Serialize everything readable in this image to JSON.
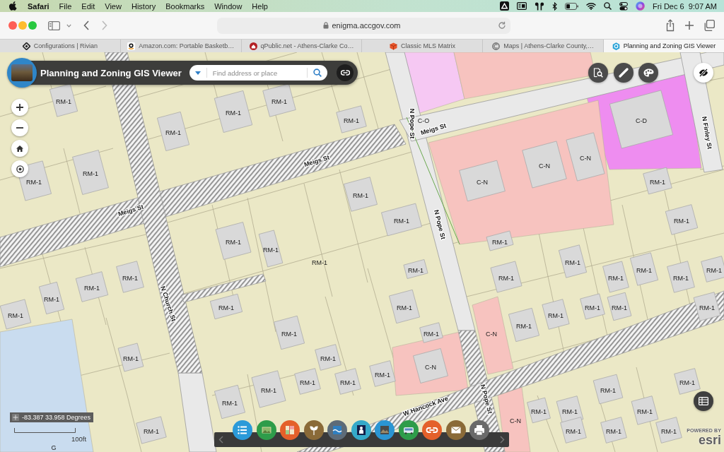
{
  "menu_bar": {
    "app": "Safari",
    "menus": [
      "File",
      "Edit",
      "View",
      "History",
      "Bookmarks",
      "Window",
      "Help"
    ],
    "date": "Fri Dec 6",
    "time": "9:07 AM"
  },
  "browser": {
    "url": "enigma.accgov.com",
    "tabs": [
      {
        "title": "Configurations | Rivian",
        "selected": false
      },
      {
        "title": "Amazon.com: Portable Basketb…",
        "selected": false
      },
      {
        "title": "qPublic.net - Athens-Clarke Co…",
        "selected": false
      },
      {
        "title": "Classic MLS Matrix",
        "selected": false
      },
      {
        "title": "Maps | Athens-Clarke County,…",
        "selected": false
      },
      {
        "title": "Planning and Zoning GIS Viewer",
        "selected": true
      }
    ]
  },
  "app": {
    "title": "Planning and Zoning GIS Viewer",
    "search": {
      "placeholder": "Find address or place"
    }
  },
  "map": {
    "streets": [
      {
        "name": "N Pope St"
      },
      {
        "name": "Meigs St"
      },
      {
        "name": "N Finley St"
      },
      {
        "name": "Meigs St"
      },
      {
        "name": "Meigs St"
      },
      {
        "name": "N Pope St"
      },
      {
        "name": "N Church St"
      },
      {
        "name": "W Hancock Ave"
      },
      {
        "name": "N Pope St"
      }
    ],
    "zones": [
      {
        "label": "RM-1"
      },
      {
        "label": "RM-1"
      },
      {
        "label": "RM-1"
      },
      {
        "label": "RM-1"
      },
      {
        "label": "C-O"
      },
      {
        "label": "C-D"
      },
      {
        "label": "RM-1"
      },
      {
        "label": "C-N"
      },
      {
        "label": "C-N"
      },
      {
        "label": "RM-1"
      },
      {
        "label": "RM-1"
      },
      {
        "label": "C-N"
      },
      {
        "label": "RM-1"
      },
      {
        "label": "RM-1"
      },
      {
        "label": "RM-1"
      },
      {
        "label": "RM-1"
      },
      {
        "label": "RM-1"
      },
      {
        "label": "RM-1"
      },
      {
        "label": "RM-1"
      },
      {
        "label": "RM-1"
      },
      {
        "label": "RM-1"
      },
      {
        "label": "RM-1"
      },
      {
        "label": "RM-1"
      },
      {
        "label": "RM-1"
      },
      {
        "label": "RM-1"
      },
      {
        "label": "RM-1"
      },
      {
        "label": "RM-1"
      },
      {
        "label": "RM-1"
      },
      {
        "label": "RM-1"
      },
      {
        "label": "RM-1"
      },
      {
        "label": "RM-1"
      },
      {
        "label": "RM-1"
      },
      {
        "label": "RM-1"
      },
      {
        "label": "RM-1"
      },
      {
        "label": "RM-1"
      },
      {
        "label": "RM-1"
      },
      {
        "label": "RM-1"
      },
      {
        "label": "RM-1"
      },
      {
        "label": "RM-1"
      },
      {
        "label": "RM-1"
      },
      {
        "label": "C-N"
      },
      {
        "label": "RM-1"
      },
      {
        "label": "RM-1"
      },
      {
        "label": "C-N"
      },
      {
        "label": "RM-1"
      },
      {
        "label": "RM-1"
      },
      {
        "label": "RM-1"
      },
      {
        "label": "RM-1"
      },
      {
        "label": "RM-1"
      },
      {
        "label": "RM-1"
      },
      {
        "label": "RM-1"
      },
      {
        "label": "RM-1"
      },
      {
        "label": "RM-1"
      },
      {
        "label": "RM-1"
      },
      {
        "label": "C-N"
      },
      {
        "label": "RM-1"
      },
      {
        "label": "RM-1"
      },
      {
        "label": "RM-1"
      },
      {
        "label": "RM-1"
      },
      {
        "label": "G"
      }
    ],
    "coordinates": "-83.387 33.958 Degrees",
    "scale": "100ft",
    "attribution": {
      "caption": "POWERED BY",
      "logo": "esri"
    }
  }
}
